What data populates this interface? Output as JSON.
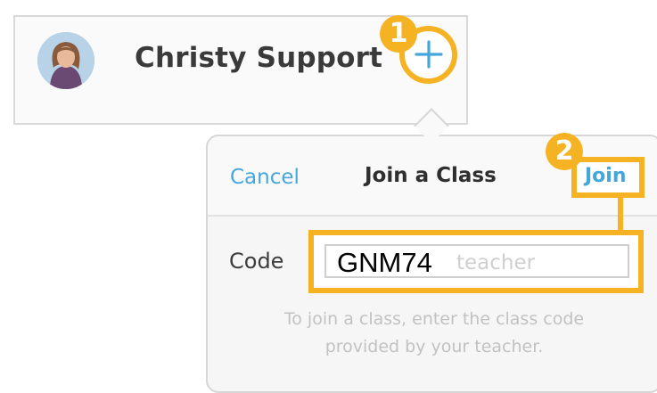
{
  "account": {
    "name": "Christy Support",
    "avatar_icon": "user-photo",
    "add_icon": "plus-icon"
  },
  "badges": {
    "step1": "1",
    "step2": "2"
  },
  "popover": {
    "cancel_label": "Cancel",
    "title": "Join a Class",
    "join_label": "Join"
  },
  "form": {
    "code_label": "Code",
    "code_value": "GNM74",
    "code_placeholder": "teacher",
    "helper_line1": "To join a class, enter the class code",
    "helper_line2": "provided by your teacher."
  },
  "colors": {
    "highlight": "#f5b324",
    "link": "#44a7dc"
  }
}
